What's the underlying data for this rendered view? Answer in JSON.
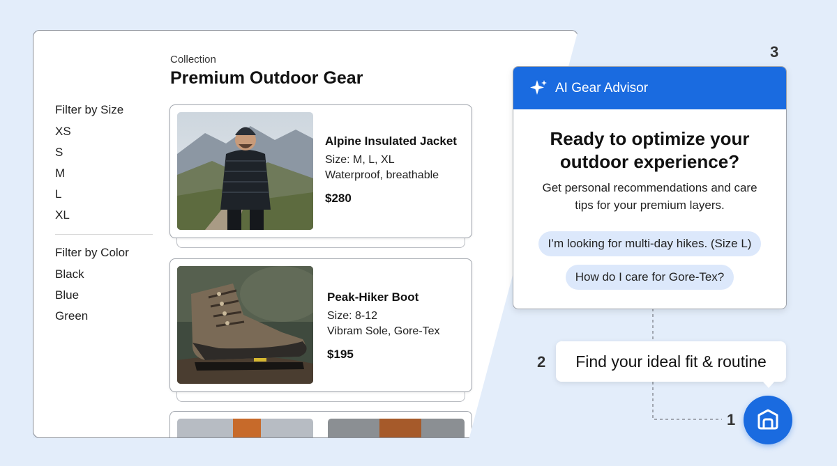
{
  "store": {
    "collection_label": "Collection",
    "title": "Premium Outdoor Gear",
    "filters": {
      "size": {
        "heading": "Filter by Size",
        "options": [
          "XS",
          "S",
          "M",
          "L",
          "XL"
        ]
      },
      "color": {
        "heading": "Filter by Color",
        "options": [
          "Black",
          "Blue",
          "Green"
        ]
      }
    },
    "products": [
      {
        "name": "Alpine Insulated Jacket",
        "size": "Size: M, L, XL",
        "feature": "Waterproof, breathable",
        "price": "$280"
      },
      {
        "name": "Peak-Hiker Boot",
        "size": "Size: 8-12",
        "feature": "Vibram Sole, Gore-Tex",
        "price": "$195"
      }
    ]
  },
  "advisor": {
    "header": "AI Gear Advisor",
    "title_line1": "Ready to optimize your",
    "title_line2": "outdoor experience?",
    "subtitle_line1": "Get personal recommendations and care",
    "subtitle_line2": "tips for your premium layers.",
    "suggestions": [
      "I’m looking for multi-day hikes. (Size L)",
      "How do I care for Gore-Tex?"
    ]
  },
  "steps": {
    "one": "1",
    "two": "2",
    "three": "3",
    "bubble": "Find your ideal fit & routine"
  },
  "colors": {
    "accent": "#1a6be0",
    "chip": "#dce8fb",
    "background": "#e3edfa"
  }
}
